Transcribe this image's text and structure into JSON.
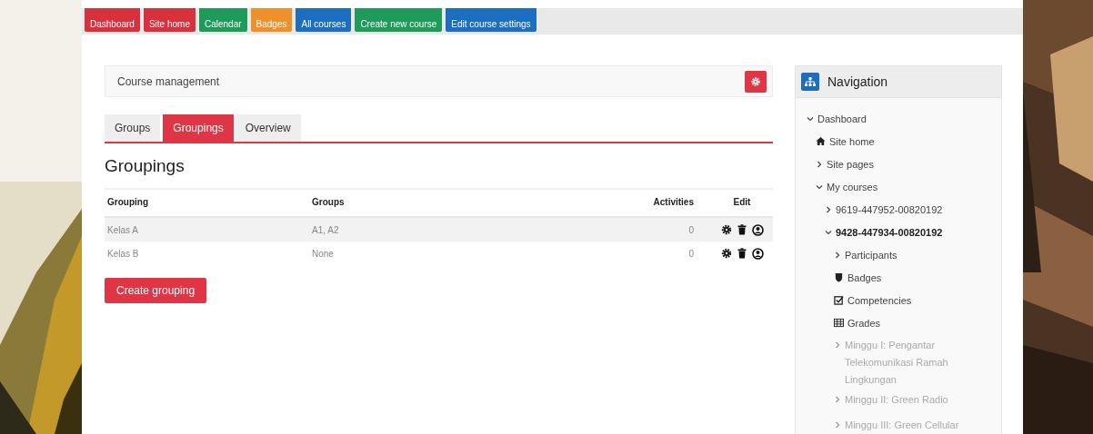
{
  "top_buttons": [
    {
      "label": "Dashboard",
      "color": "#d9303e"
    },
    {
      "label": "Site home",
      "color": "#d9303e"
    },
    {
      "label": "Calendar",
      "color": "#1e9a5a"
    },
    {
      "label": "Badges",
      "color": "#f0902a"
    },
    {
      "label": "All courses",
      "color": "#1c6fc0"
    },
    {
      "label": "Create new course",
      "color": "#1e9a5a"
    },
    {
      "label": "Edit course settings",
      "color": "#1c6fc0"
    }
  ],
  "header": {
    "title": "Course management"
  },
  "tabs": [
    {
      "label": "Groups",
      "selected": false
    },
    {
      "label": "Groupings",
      "selected": true
    },
    {
      "label": "Overview",
      "selected": false
    }
  ],
  "heading": "Groupings",
  "table": {
    "columns": [
      "Grouping",
      "Groups",
      "Activities",
      "Edit"
    ],
    "rows": [
      {
        "grouping": "Kelas A",
        "groups": "A1, A2",
        "activities": "0"
      },
      {
        "grouping": "Kelas B",
        "groups": "None",
        "activities": "0"
      }
    ]
  },
  "create_button": "Create grouping",
  "navigation": {
    "title": "Navigation",
    "items": [
      {
        "kind": "branch",
        "label": "Dashboard",
        "expanded": true,
        "children": [
          {
            "kind": "home",
            "label": "Site home"
          },
          {
            "kind": "branch",
            "label": "Site pages",
            "expanded": false
          },
          {
            "kind": "branch",
            "label": "My courses",
            "expanded": true,
            "children": [
              {
                "kind": "branch",
                "label": "9619-447952-00820192",
                "expanded": false
              },
              {
                "kind": "branch",
                "label": "9428-447934-00820192",
                "expanded": true,
                "current": true,
                "children": [
                  {
                    "kind": "branch",
                    "label": "Participants",
                    "expanded": false
                  },
                  {
                    "kind": "badges",
                    "label": "Badges"
                  },
                  {
                    "kind": "competencies",
                    "label": "Competencies"
                  },
                  {
                    "kind": "grades",
                    "label": "Grades"
                  },
                  {
                    "kind": "branch",
                    "label": "Minggu I: Pengantar Telekomunikasi Ramah Lingkungan",
                    "expanded": false,
                    "dimmed": true
                  },
                  {
                    "kind": "branch",
                    "label": "Minggu II: Green Radio",
                    "expanded": false,
                    "dimmed": true
                  },
                  {
                    "kind": "branch",
                    "label": "Minggu III: Green Cellular",
                    "expanded": false,
                    "dimmed": true
                  }
                ]
              }
            ]
          }
        ]
      }
    ]
  }
}
